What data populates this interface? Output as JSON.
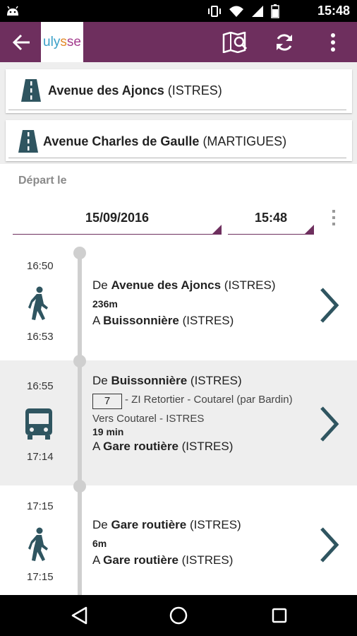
{
  "status_bar": {
    "time": "15:48",
    "icons": [
      "android-icon",
      "vibrate-icon",
      "wifi-icon",
      "signal-icon",
      "battery-icon"
    ]
  },
  "toolbar": {
    "logo_parts": [
      "u",
      "ly",
      "s",
      "se"
    ],
    "icons": [
      "back-arrow-icon",
      "map-search-icon",
      "refresh-icon",
      "overflow-menu-icon"
    ],
    "bg_color": "#6e2f5e"
  },
  "origin": {
    "name": "Avenue des Ajoncs",
    "city": "(ISTRES)"
  },
  "destination": {
    "name": "Avenue Charles de Gaulle",
    "city": "(MARTIGUES)"
  },
  "departure": {
    "label": "Départ le",
    "date": "15/09/2016",
    "time": "15:48"
  },
  "steps": [
    {
      "mode": "walk",
      "start_time": "16:50",
      "end_time": "16:53",
      "from_prefix": "De",
      "from_name": "Avenue des Ajoncs",
      "from_city": "(ISTRES)",
      "detail": "236m",
      "to_prefix": "A",
      "to_name": "Buissonnière",
      "to_city": "(ISTRES)"
    },
    {
      "mode": "bus",
      "start_time": "16:55",
      "end_time": "17:14",
      "from_prefix": "De",
      "from_name": "Buissonnière",
      "from_city": "(ISTRES)",
      "line_number": "7",
      "line_name": "- ZI Retortier - Coutarel (par Bardin)",
      "direction": "Vers Coutarel - ISTRES",
      "duration": "19 min",
      "to_prefix": "A",
      "to_name": "Gare routière",
      "to_city": "(ISTRES)"
    },
    {
      "mode": "walk",
      "start_time": "17:15",
      "end_time": "17:15",
      "from_prefix": "De",
      "from_name": "Gare routière",
      "from_city": "(ISTRES)",
      "detail": "6m",
      "to_prefix": "A",
      "to_name": "Gare routière",
      "to_city": "(ISTRES)"
    }
  ],
  "colors": {
    "accent": "#6e2f5e",
    "icon_teal": "#2f5560"
  }
}
